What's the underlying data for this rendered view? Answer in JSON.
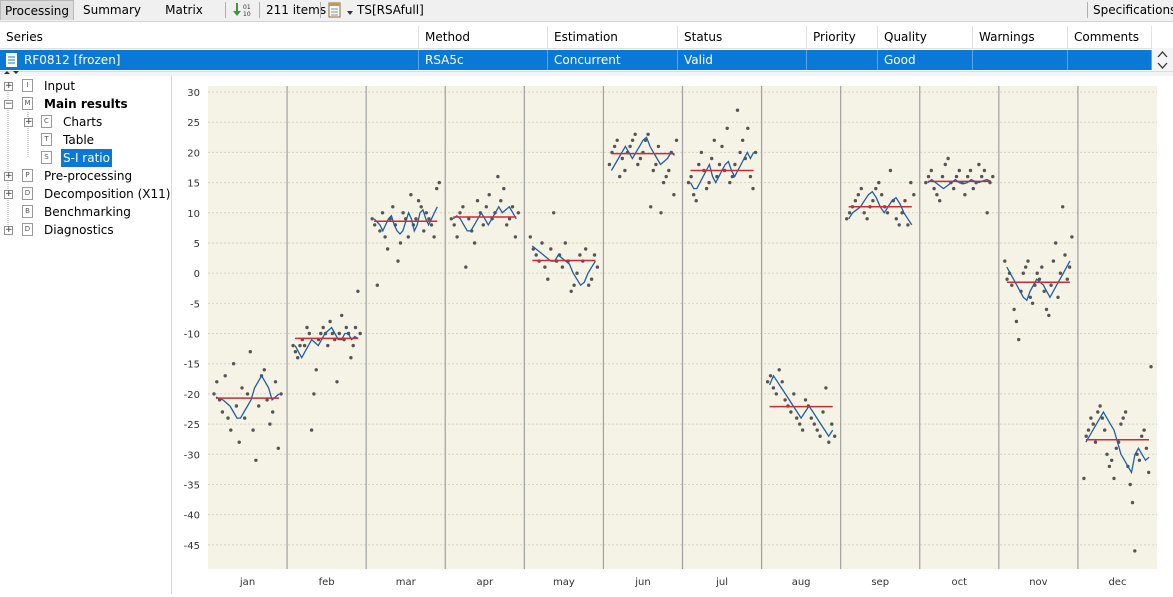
{
  "toolbar": {
    "tabs": [
      "Processing",
      "Summary",
      "Matrix"
    ],
    "item_count": "211 items",
    "spec_name": "TS[RSAfull]",
    "specifications_label": "Specifications",
    "icons": [
      "download-binary-icon",
      "spec-sheet-icon",
      "dropdown-triangle-icon"
    ]
  },
  "grid": {
    "columns": [
      "Series",
      "Method",
      "Estimation",
      "Status",
      "Priority",
      "Quality",
      "Warnings",
      "Comments"
    ],
    "row": {
      "series": "RF0812 [frozen]",
      "method": "RSA5c",
      "estimation": "Concurrent",
      "status": "Valid",
      "priority": "",
      "quality": "Good",
      "warnings": "",
      "comments": ""
    },
    "selected_color": "#0a78d7"
  },
  "tree": {
    "nodes": [
      {
        "label": "Input",
        "icon": "I"
      },
      {
        "label": "Main results",
        "icon": "M"
      },
      {
        "label": "Charts",
        "icon": "C"
      },
      {
        "label": "Table",
        "icon": "T"
      },
      {
        "label": "S-I ratio",
        "icon": "S"
      },
      {
        "label": "Pre-processing",
        "icon": "P"
      },
      {
        "label": "Decomposition (X11)",
        "icon": "D"
      },
      {
        "label": "Benchmarking",
        "icon": "B"
      },
      {
        "label": "Diagnostics",
        "icon": "D"
      }
    ]
  },
  "chart_data": {
    "type": "scatter",
    "ylim": [
      -49,
      31
    ],
    "yticks": [
      30,
      25,
      20,
      15,
      10,
      5,
      0,
      -5,
      -10,
      -15,
      -20,
      -25,
      -30,
      -35,
      -40,
      -45
    ],
    "categories": [
      "jan",
      "feb",
      "mar",
      "apr",
      "may",
      "jun",
      "jul",
      "aug",
      "sep",
      "oct",
      "nov",
      "dec"
    ],
    "grid": true,
    "colors": {
      "panel": "#f5f2e6",
      "points": "#555555",
      "trend": "#1f5fa0",
      "mean": "#cc2b36",
      "divider": "#a0a0a0"
    },
    "panels": [
      {
        "mean": -20.7,
        "points": [
          -20,
          -18,
          -21,
          -23,
          -17,
          -24,
          -26,
          -15,
          -22,
          -28,
          -19,
          -24,
          -20,
          -13,
          -26,
          -31,
          -22,
          -17,
          -16,
          -21,
          -25,
          -23,
          -18,
          -29,
          -20
        ],
        "trend": [
          -20.5,
          -20.8,
          -21,
          -21.5,
          -22,
          -23,
          -24,
          -24,
          -23,
          -22,
          -21,
          -19,
          -18,
          -17,
          -18,
          -19,
          -21,
          -20.5,
          -20
        ]
      },
      {
        "mean": -10.8,
        "points": [
          -12,
          -13,
          -14,
          -12,
          -11,
          -12,
          -9,
          -10,
          -26,
          -20,
          -16,
          -11,
          -10,
          -9,
          -10,
          -12,
          -8,
          -10,
          -11,
          -18,
          -10,
          -7,
          -11,
          -9,
          -10,
          -14,
          -12,
          -9,
          -3,
          -10
        ],
        "trend": [
          -12,
          -13,
          -14,
          -13,
          -12,
          -11,
          -11.5,
          -12,
          -11,
          -10,
          -9.5,
          -9,
          -10,
          -11,
          -11,
          -10,
          -10,
          -11,
          -10.5,
          -10.8
        ]
      },
      {
        "mean": 8.6,
        "points": [
          9,
          8,
          -2,
          7,
          10,
          6,
          4,
          9,
          11,
          8,
          2,
          5,
          10,
          9,
          6,
          13,
          8,
          9,
          12,
          11,
          7,
          10,
          9,
          8,
          6,
          14,
          15
        ],
        "trend": [
          9,
          8.5,
          8,
          7,
          8,
          9,
          9.5,
          8,
          7,
          6.5,
          7,
          8.5,
          10,
          9,
          7,
          8,
          10,
          10.5,
          9,
          8,
          9,
          10,
          11
        ]
      },
      {
        "mean": 9.3,
        "points": [
          9,
          8,
          6,
          10,
          11,
          1,
          9,
          7,
          5,
          12,
          10,
          8,
          11,
          13,
          9,
          10,
          16,
          12,
          14,
          8,
          9,
          11,
          6,
          10
        ],
        "trend": [
          9,
          9.5,
          9,
          8,
          7,
          7,
          8,
          9,
          10,
          9,
          8,
          9,
          10,
          11,
          10,
          10.5,
          11,
          10,
          9
        ]
      },
      {
        "mean": 2.1,
        "points": [
          6,
          4,
          3,
          2,
          5,
          1,
          -1,
          4,
          10,
          2,
          3,
          1,
          5,
          2,
          -3,
          -2,
          0,
          3,
          2,
          4,
          -2,
          -1,
          3,
          1
        ],
        "trend": [
          4.5,
          4,
          3.5,
          3,
          2.5,
          2,
          2,
          3,
          2.5,
          2,
          1.5,
          0,
          -1,
          -2,
          -1.5,
          0,
          1,
          2
        ]
      },
      {
        "mean": 19.8,
        "points": [
          18,
          20,
          21,
          22,
          16,
          19,
          17,
          20,
          21,
          22,
          23,
          18,
          19,
          20,
          22,
          23,
          11,
          17,
          18,
          21,
          10,
          15,
          16,
          17,
          20,
          13,
          22
        ],
        "trend": [
          17,
          18,
          19,
          20,
          21,
          20,
          19,
          20,
          21,
          22,
          22.5,
          21,
          20,
          19,
          18,
          18.5,
          19,
          20,
          19.5
        ]
      },
      {
        "mean": 17.0,
        "points": [
          15,
          16,
          13,
          12,
          18,
          20,
          17,
          14,
          15,
          19,
          22,
          16,
          18,
          21,
          17,
          24,
          15,
          16,
          18,
          27,
          20,
          22,
          19,
          24,
          16,
          14,
          20
        ],
        "trend": [
          15,
          14,
          14,
          15,
          16,
          17,
          18,
          16,
          15,
          16,
          17,
          18,
          18.5,
          17,
          16,
          17,
          18,
          19,
          20,
          19,
          20
        ]
      },
      {
        "mean": -22.1,
        "points": [
          -18,
          -17,
          -19,
          -20,
          -16,
          -18,
          -21,
          -22,
          -23,
          -20,
          -24,
          -25,
          -26,
          -21,
          -22,
          -24,
          -25,
          -26,
          -27,
          -23,
          -19,
          -28,
          -25,
          -27
        ],
        "trend": [
          -18.5,
          -17,
          -18,
          -19,
          -20,
          -21,
          -22,
          -23,
          -24,
          -23,
          -22,
          -23,
          -24,
          -25,
          -26,
          -27,
          -26
        ]
      },
      {
        "mean": 11.0,
        "points": [
          9,
          10,
          11,
          12,
          13,
          14,
          10,
          9,
          11,
          12,
          14,
          15,
          13,
          11,
          10,
          17,
          12,
          9,
          8,
          10,
          12,
          8,
          15,
          13
        ],
        "trend": [
          9,
          10,
          10.5,
          11,
          12,
          13,
          13.5,
          12.5,
          11,
          10,
          11,
          12,
          12.5,
          11.5,
          10,
          9,
          8
        ]
      },
      {
        "mean": 15.2,
        "points": [
          15,
          16,
          17,
          14,
          13,
          12,
          16,
          18,
          19,
          15,
          14,
          16,
          17,
          15,
          13,
          16,
          17,
          14,
          15,
          18,
          16,
          17,
          10,
          15,
          16
        ],
        "trend": [
          15,
          15.5,
          15,
          14.5,
          14,
          14.5,
          15,
          15.5,
          15,
          14.8,
          15,
          15.5,
          15.2,
          15,
          15.3,
          15.5,
          15.2
        ]
      },
      {
        "mean": -1.5,
        "points": [
          2,
          -1,
          0,
          -2,
          -6,
          -8,
          -11,
          -3,
          0,
          1,
          2,
          -4,
          -5,
          -2,
          0,
          -1,
          1,
          -3,
          -6,
          -7,
          -2,
          2,
          5,
          -4,
          0,
          11,
          3,
          -1,
          1,
          6
        ],
        "trend": [
          1,
          0,
          -1,
          -2,
          -3,
          -4,
          -4.5,
          -3,
          -2,
          -1,
          -1.5,
          -2,
          -3,
          -4,
          -3,
          -2,
          -1,
          0,
          1,
          2
        ]
      },
      {
        "mean": -27.6,
        "points": [
          -34,
          -27,
          -26,
          -24,
          -25,
          -28,
          -23,
          -22,
          -24,
          -26,
          -30,
          -32,
          -31,
          -34,
          -29,
          -28,
          -25,
          -24,
          -23,
          -32,
          -35,
          -38,
          -46,
          -30,
          -31,
          -27,
          -26,
          -29,
          -33,
          -15.5
        ],
        "trend": [
          -28,
          -27,
          -26,
          -25,
          -24,
          -23,
          -24,
          -25,
          -26,
          -28,
          -30,
          -31,
          -32,
          -33,
          -30,
          -29,
          -30,
          -31,
          -30.5
        ]
      }
    ]
  }
}
